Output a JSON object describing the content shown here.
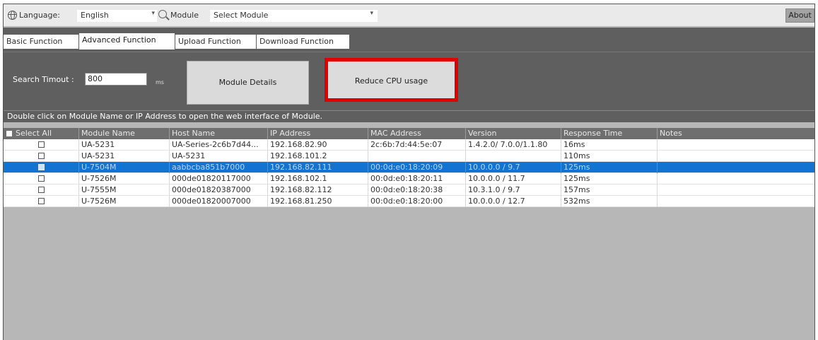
{
  "toolbar": {
    "language_label": "Language:",
    "language_value": "English",
    "language_icon": "globe-icon",
    "module_label": "Module",
    "module_value": "Select Module",
    "module_icon": "search-icon",
    "about_label": "About"
  },
  "tabs": [
    {
      "label": "Basic Function",
      "active": false
    },
    {
      "label": "Advanced Function",
      "active": true
    },
    {
      "label": "Upload Function",
      "active": false
    },
    {
      "label": "Download Function",
      "active": false
    }
  ],
  "panel": {
    "timeout_label": "Search Timout :",
    "timeout_value": "800",
    "timeout_unit": "ms",
    "module_details_label": "Module Details",
    "reduce_cpu_label": "Reduce CPU usage",
    "highlight_color": "#e00000"
  },
  "info_text": "Double click on Module Name or IP Address to open the web interface of Module.",
  "grid": {
    "columns": [
      "Select All",
      "Module Name",
      "Host Name",
      "IP Address",
      "MAC Address",
      "Version",
      "Response Time",
      "Notes"
    ],
    "rows": [
      {
        "checked": false,
        "selected": false,
        "module": "UA-5231",
        "host": "UA-Series-2c6b7d44...",
        "ip": "192.168.82.90",
        "mac": "2c:6b:7d:44:5e:07",
        "version": "1.4.2.0/ 7.0.0/1.1.80",
        "response": "16ms",
        "notes": ""
      },
      {
        "checked": false,
        "selected": false,
        "module": "UA-5231",
        "host": "UA-5231",
        "ip": "192.168.101.2",
        "mac": "",
        "version": "",
        "response": "110ms",
        "notes": ""
      },
      {
        "checked": true,
        "selected": true,
        "module": "U-7504M",
        "host": "aabbcba851b7000",
        "ip": "192.168.82.111",
        "mac": "00:0d:e0:18:20:09",
        "version": "10.0.0.0 / 9.7",
        "response": "125ms",
        "notes": ""
      },
      {
        "checked": false,
        "selected": false,
        "module": "U-7526M",
        "host": "000de01820117000",
        "ip": "192.168.102.1",
        "mac": "00:0d:e0:18:20:11",
        "version": "10.0.0.0 / 11.7",
        "response": "125ms",
        "notes": ""
      },
      {
        "checked": false,
        "selected": false,
        "module": "U-7555M",
        "host": "000de01820387000",
        "ip": "192.168.82.112",
        "mac": "00:0d:e0:18:20:38",
        "version": "10.3.1.0 / 9.7",
        "response": "157ms",
        "notes": ""
      },
      {
        "checked": false,
        "selected": false,
        "module": "U-7526M",
        "host": "000de01820007000",
        "ip": "192.168.81.250",
        "mac": "00:0d:e0:18:20:00",
        "version": "10.0.0.0 / 12.7",
        "response": "532ms",
        "notes": ""
      }
    ]
  },
  "colors": {
    "selected_row": "#1273d1",
    "dark_panel": "#5f5f5f",
    "empty_area": "#b7b7b7"
  }
}
